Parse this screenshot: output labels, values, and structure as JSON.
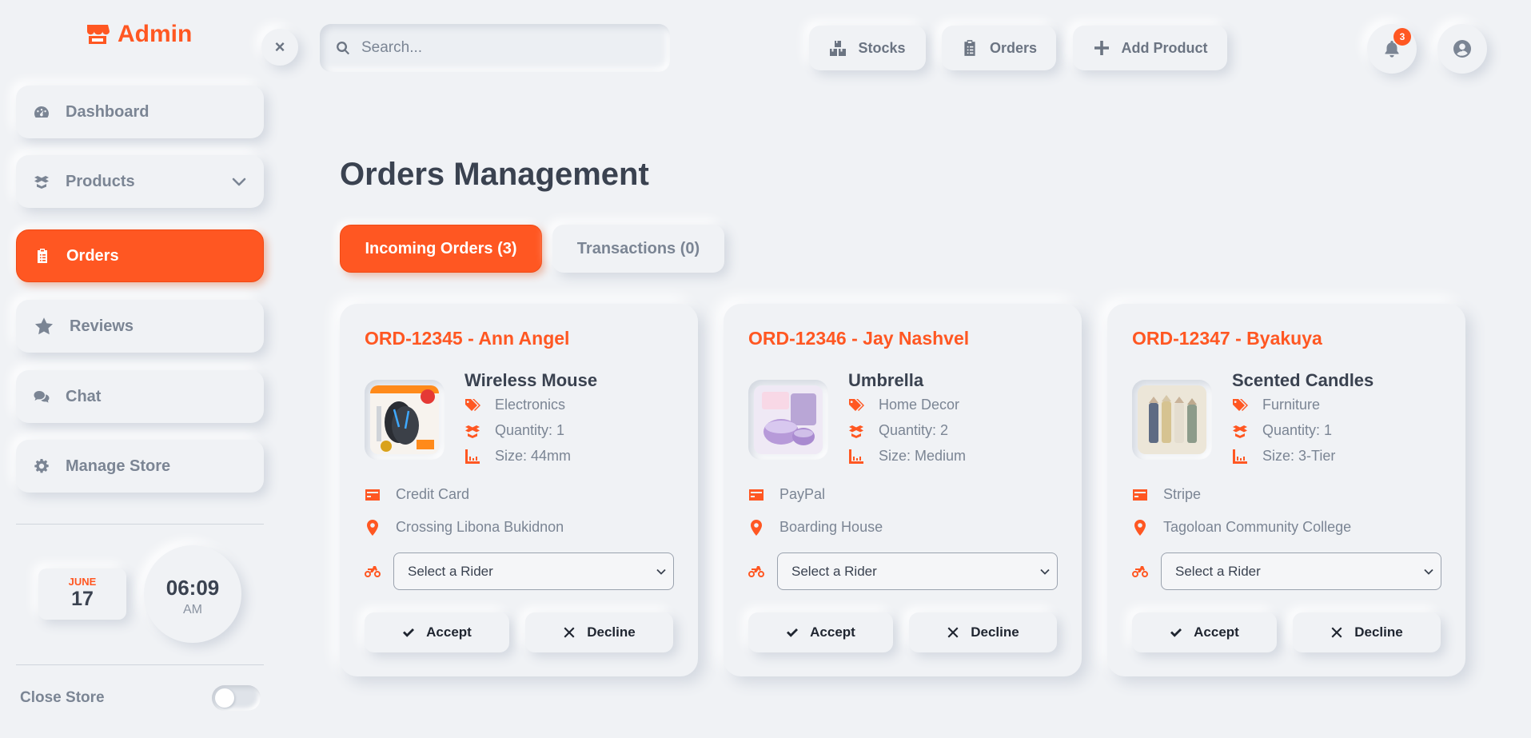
{
  "brand": {
    "name": "Admin"
  },
  "sidebar": {
    "items": [
      {
        "label": "Dashboard",
        "icon": "gauge-icon"
      },
      {
        "label": "Products",
        "icon": "box-icon"
      },
      {
        "label": "Orders",
        "icon": "clipboard-icon"
      },
      {
        "label": "Reviews",
        "icon": "star-icon"
      },
      {
        "label": "Chat",
        "icon": "chat-icon"
      },
      {
        "label": "Manage Store",
        "icon": "gear-icon"
      }
    ],
    "active": "Orders",
    "date": {
      "month": "JUNE",
      "day": "17"
    },
    "clock": {
      "time": "06:09",
      "ampm": "AM"
    },
    "close_store_label": "Close Store",
    "close_store_on": false
  },
  "topbar": {
    "close_label": "×",
    "search_placeholder": "Search...",
    "buttons": {
      "stocks": "Stocks",
      "orders": "Orders",
      "add_product": "Add Product"
    },
    "notification_count": "3"
  },
  "main": {
    "title": "Orders Management",
    "tabs": {
      "incoming": "Incoming Orders (3)",
      "transactions": "Transactions (0)"
    }
  },
  "orders": [
    {
      "id_label": "ORD-12345 - Ann Angel",
      "product": "Wireless Mouse",
      "category": "Electronics",
      "quantity": "Quantity: 1",
      "size": "Size: 44mm",
      "payment": "Credit Card",
      "address": "Crossing Libona Bukidnon",
      "rider_placeholder": "Select a Rider",
      "accept": "Accept",
      "decline": "Decline"
    },
    {
      "id_label": "ORD-12346 - Jay Nashvel",
      "product": "Umbrella",
      "category": "Home Decor",
      "quantity": "Quantity: 2",
      "size": "Size: Medium",
      "payment": "PayPal",
      "address": "Boarding House",
      "rider_placeholder": "Select a Rider",
      "accept": "Accept",
      "decline": "Decline"
    },
    {
      "id_label": "ORD-12347 - Byakuya",
      "product": "Scented Candles",
      "category": "Furniture",
      "quantity": "Quantity: 1",
      "size": "Size: 3-Tier",
      "payment": "Stripe",
      "address": "Tagoloan Community College",
      "rider_placeholder": "Select a Rider",
      "accept": "Accept",
      "decline": "Decline"
    }
  ],
  "colors": {
    "accent": "#ff5722",
    "background": "#f0f2f5",
    "muted_text": "#7b8594",
    "dark_text": "#3a4250"
  }
}
